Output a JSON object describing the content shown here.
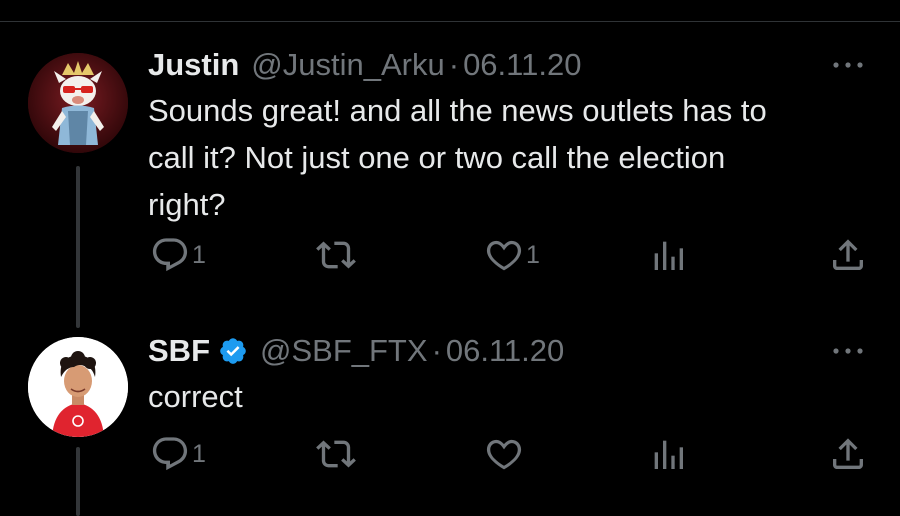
{
  "colors": {
    "background": "#000000",
    "text_primary": "#e7e9ea",
    "text_secondary": "#71767b",
    "verified_blue": "#1d9bf0",
    "thread_line": "#333639"
  },
  "tweets": [
    {
      "name": "Justin",
      "handle": "@Justin_Arku",
      "separator": "·",
      "date": "06.11.20",
      "lines": [
        "Sounds great! and all the news outlets has to",
        "call it? Not just one or two call the election",
        "right?"
      ],
      "verified": false,
      "avatar": "cartoon-fox-avatar",
      "actions": {
        "reply_icon": "reply-icon",
        "reply_count": "1",
        "retweet_icon": "retweet-icon",
        "retweet_count": "",
        "like_icon": "heart-icon",
        "like_count": "1",
        "views_icon": "views-icon",
        "share_icon": "share-icon"
      },
      "more_icon": "more-icon"
    },
    {
      "name": "SBF",
      "handle": "@SBF_FTX",
      "separator": "·",
      "date": "06.11.20",
      "lines": [
        "correct"
      ],
      "verified": true,
      "verified_icon": "verified-badge-icon",
      "avatar": "profile-photo-avatar",
      "actions": {
        "reply_icon": "reply-icon",
        "reply_count": "1",
        "retweet_icon": "retweet-icon",
        "retweet_count": "",
        "like_icon": "heart-icon",
        "like_count": "",
        "views_icon": "views-icon",
        "share_icon": "share-icon"
      },
      "more_icon": "more-icon"
    }
  ]
}
